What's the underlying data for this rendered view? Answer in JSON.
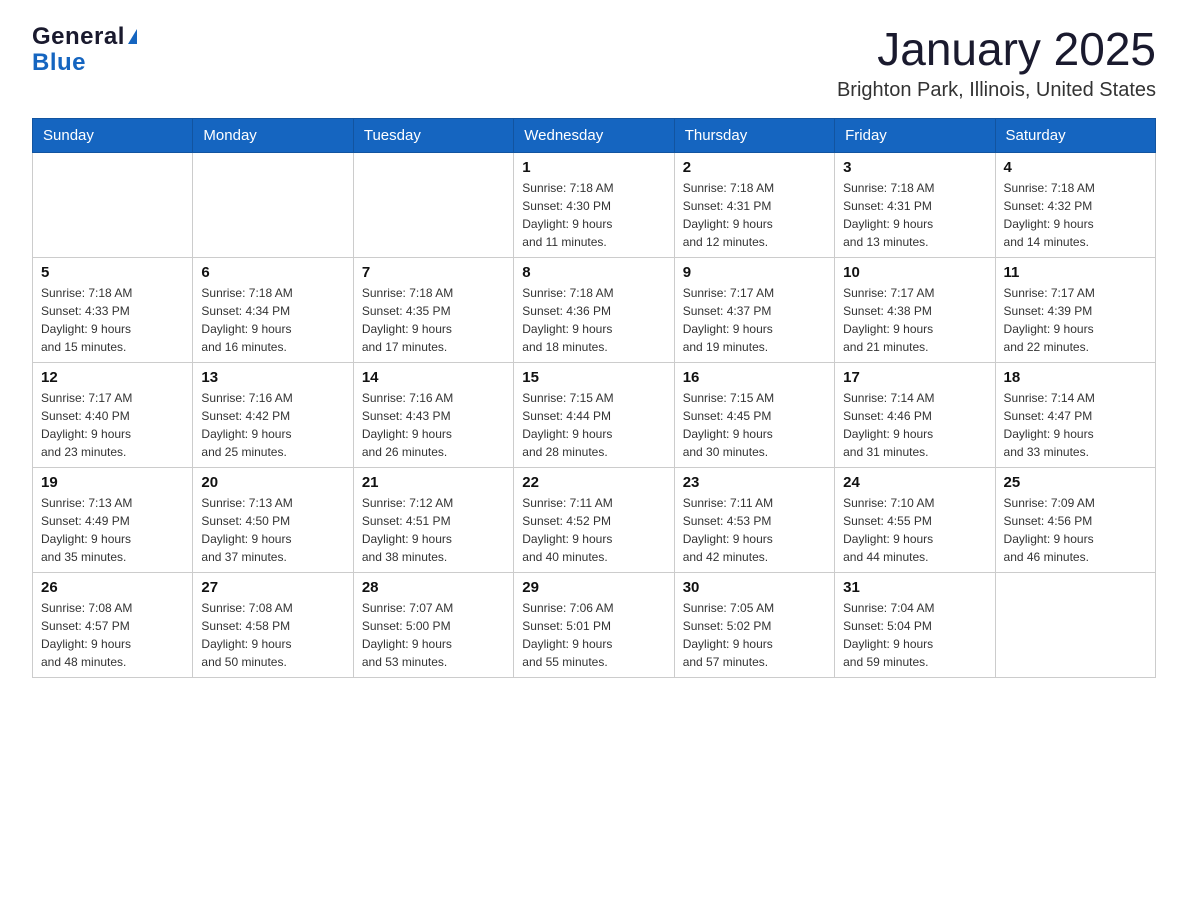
{
  "header": {
    "logo_general": "General",
    "logo_blue": "Blue",
    "title": "January 2025",
    "subtitle": "Brighton Park, Illinois, United States"
  },
  "weekdays": [
    "Sunday",
    "Monday",
    "Tuesday",
    "Wednesday",
    "Thursday",
    "Friday",
    "Saturday"
  ],
  "weeks": [
    [
      {
        "day": "",
        "info": ""
      },
      {
        "day": "",
        "info": ""
      },
      {
        "day": "",
        "info": ""
      },
      {
        "day": "1",
        "info": "Sunrise: 7:18 AM\nSunset: 4:30 PM\nDaylight: 9 hours\nand 11 minutes."
      },
      {
        "day": "2",
        "info": "Sunrise: 7:18 AM\nSunset: 4:31 PM\nDaylight: 9 hours\nand 12 minutes."
      },
      {
        "day": "3",
        "info": "Sunrise: 7:18 AM\nSunset: 4:31 PM\nDaylight: 9 hours\nand 13 minutes."
      },
      {
        "day": "4",
        "info": "Sunrise: 7:18 AM\nSunset: 4:32 PM\nDaylight: 9 hours\nand 14 minutes."
      }
    ],
    [
      {
        "day": "5",
        "info": "Sunrise: 7:18 AM\nSunset: 4:33 PM\nDaylight: 9 hours\nand 15 minutes."
      },
      {
        "day": "6",
        "info": "Sunrise: 7:18 AM\nSunset: 4:34 PM\nDaylight: 9 hours\nand 16 minutes."
      },
      {
        "day": "7",
        "info": "Sunrise: 7:18 AM\nSunset: 4:35 PM\nDaylight: 9 hours\nand 17 minutes."
      },
      {
        "day": "8",
        "info": "Sunrise: 7:18 AM\nSunset: 4:36 PM\nDaylight: 9 hours\nand 18 minutes."
      },
      {
        "day": "9",
        "info": "Sunrise: 7:17 AM\nSunset: 4:37 PM\nDaylight: 9 hours\nand 19 minutes."
      },
      {
        "day": "10",
        "info": "Sunrise: 7:17 AM\nSunset: 4:38 PM\nDaylight: 9 hours\nand 21 minutes."
      },
      {
        "day": "11",
        "info": "Sunrise: 7:17 AM\nSunset: 4:39 PM\nDaylight: 9 hours\nand 22 minutes."
      }
    ],
    [
      {
        "day": "12",
        "info": "Sunrise: 7:17 AM\nSunset: 4:40 PM\nDaylight: 9 hours\nand 23 minutes."
      },
      {
        "day": "13",
        "info": "Sunrise: 7:16 AM\nSunset: 4:42 PM\nDaylight: 9 hours\nand 25 minutes."
      },
      {
        "day": "14",
        "info": "Sunrise: 7:16 AM\nSunset: 4:43 PM\nDaylight: 9 hours\nand 26 minutes."
      },
      {
        "day": "15",
        "info": "Sunrise: 7:15 AM\nSunset: 4:44 PM\nDaylight: 9 hours\nand 28 minutes."
      },
      {
        "day": "16",
        "info": "Sunrise: 7:15 AM\nSunset: 4:45 PM\nDaylight: 9 hours\nand 30 minutes."
      },
      {
        "day": "17",
        "info": "Sunrise: 7:14 AM\nSunset: 4:46 PM\nDaylight: 9 hours\nand 31 minutes."
      },
      {
        "day": "18",
        "info": "Sunrise: 7:14 AM\nSunset: 4:47 PM\nDaylight: 9 hours\nand 33 minutes."
      }
    ],
    [
      {
        "day": "19",
        "info": "Sunrise: 7:13 AM\nSunset: 4:49 PM\nDaylight: 9 hours\nand 35 minutes."
      },
      {
        "day": "20",
        "info": "Sunrise: 7:13 AM\nSunset: 4:50 PM\nDaylight: 9 hours\nand 37 minutes."
      },
      {
        "day": "21",
        "info": "Sunrise: 7:12 AM\nSunset: 4:51 PM\nDaylight: 9 hours\nand 38 minutes."
      },
      {
        "day": "22",
        "info": "Sunrise: 7:11 AM\nSunset: 4:52 PM\nDaylight: 9 hours\nand 40 minutes."
      },
      {
        "day": "23",
        "info": "Sunrise: 7:11 AM\nSunset: 4:53 PM\nDaylight: 9 hours\nand 42 minutes."
      },
      {
        "day": "24",
        "info": "Sunrise: 7:10 AM\nSunset: 4:55 PM\nDaylight: 9 hours\nand 44 minutes."
      },
      {
        "day": "25",
        "info": "Sunrise: 7:09 AM\nSunset: 4:56 PM\nDaylight: 9 hours\nand 46 minutes."
      }
    ],
    [
      {
        "day": "26",
        "info": "Sunrise: 7:08 AM\nSunset: 4:57 PM\nDaylight: 9 hours\nand 48 minutes."
      },
      {
        "day": "27",
        "info": "Sunrise: 7:08 AM\nSunset: 4:58 PM\nDaylight: 9 hours\nand 50 minutes."
      },
      {
        "day": "28",
        "info": "Sunrise: 7:07 AM\nSunset: 5:00 PM\nDaylight: 9 hours\nand 53 minutes."
      },
      {
        "day": "29",
        "info": "Sunrise: 7:06 AM\nSunset: 5:01 PM\nDaylight: 9 hours\nand 55 minutes."
      },
      {
        "day": "30",
        "info": "Sunrise: 7:05 AM\nSunset: 5:02 PM\nDaylight: 9 hours\nand 57 minutes."
      },
      {
        "day": "31",
        "info": "Sunrise: 7:04 AM\nSunset: 5:04 PM\nDaylight: 9 hours\nand 59 minutes."
      },
      {
        "day": "",
        "info": ""
      }
    ]
  ]
}
